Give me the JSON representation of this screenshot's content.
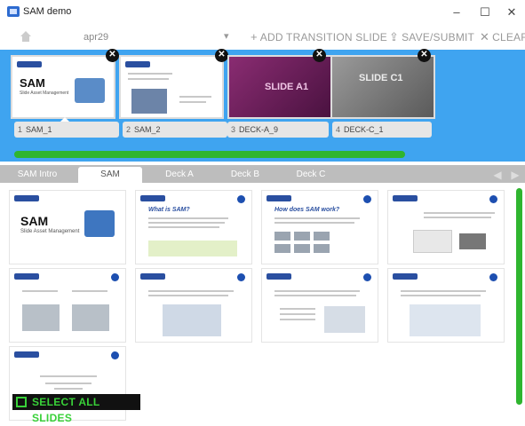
{
  "window": {
    "title": "SAM demo",
    "minimize": "–",
    "maximize": "☐",
    "close": "✕"
  },
  "toolbar": {
    "deck_name": "apr29",
    "dropdown_glyph": "▾",
    "add_transition": "ADD TRANSITION SLIDE",
    "save_submit": "SAVE/SUBMIT",
    "clear": "CLEAR"
  },
  "strip": {
    "slides": [
      {
        "num": "1",
        "label": "SAM_1",
        "title": "SAM",
        "subtitle": "Slide Asset Management"
      },
      {
        "num": "2",
        "label": "SAM_2"
      },
      {
        "num": "3",
        "label": "DECK-A_9",
        "text": "SLIDE A1"
      },
      {
        "num": "4",
        "label": "DECK-C_1",
        "text": "SLIDE C1"
      }
    ],
    "progress": 1.0
  },
  "tabs": [
    "SAM Intro",
    "SAM",
    "Deck A",
    "Deck B",
    "Deck C"
  ],
  "active_tab": "SAM",
  "thumbs": [
    {
      "title": "SAM",
      "subtitle": "Slide Asset Management"
    },
    {
      "title": "What is SAM?"
    },
    {
      "title": "How does SAM work?"
    },
    {
      "title": ""
    },
    {
      "title": ""
    },
    {
      "title": ""
    },
    {
      "title": ""
    },
    {
      "title": ""
    },
    {
      "title": ""
    }
  ],
  "select_all": "SELECT ALL SLIDES",
  "colors": {
    "accent_blue": "#3fa4f0",
    "progress_green": "#2fb52f",
    "select_green": "#39d139"
  }
}
